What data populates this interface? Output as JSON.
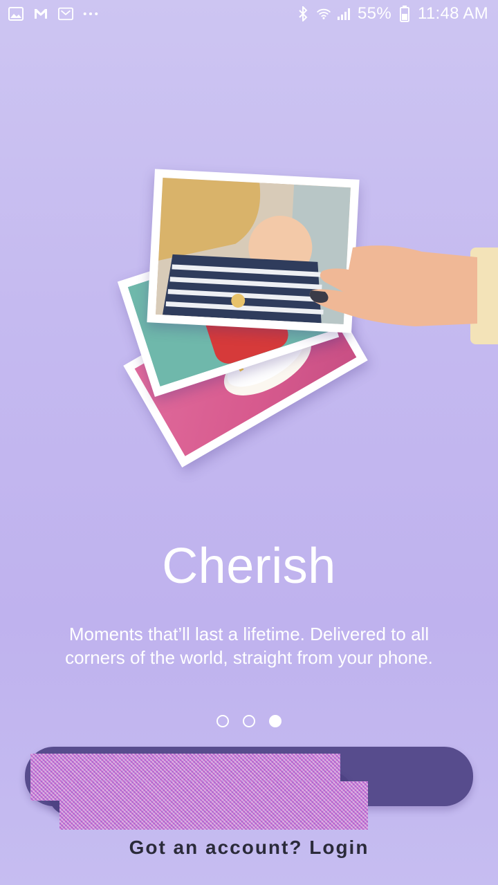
{
  "status_bar": {
    "battery": "55%",
    "time": "11:48 AM",
    "left_icons": [
      "gallery-icon",
      "gmail-icon",
      "gmail-icon",
      "more-dots-icon"
    ],
    "right_icons": [
      "bluetooth-icon",
      "wifi-icon",
      "signal-icon",
      "battery-icon"
    ]
  },
  "onboarding": {
    "title": "Cherish",
    "subtitle": "Moments that’ll last a lifetime. Delivered to all corners of the world, straight from your phone.",
    "page_count": 3,
    "active_page": 3
  },
  "actions": {
    "login_text": "Got an account? Login"
  },
  "colors": {
    "background": "#c5baf0",
    "button": "#574c8d",
    "text": "#ffffff",
    "login_text": "#2b2b3a"
  }
}
